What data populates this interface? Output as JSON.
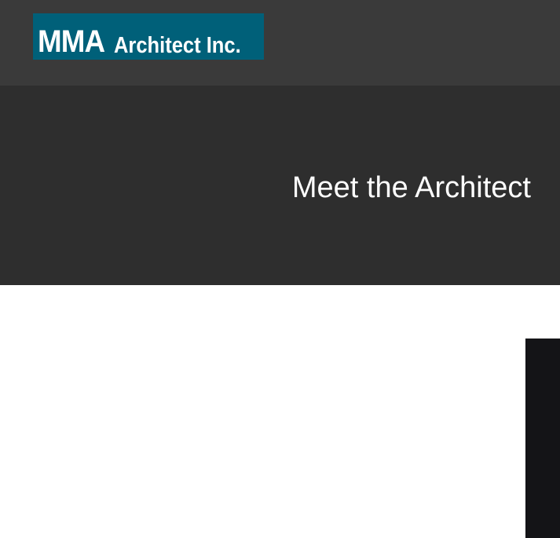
{
  "header": {
    "logo": {
      "mark": "MMA",
      "text": "Architect Inc.",
      "background_color": "#006079"
    },
    "background_color": "#3a3a3a"
  },
  "hero": {
    "title": "Meet the Architect",
    "background_color": "#2e2e2e"
  },
  "content": {
    "side_panel_color": "#141417"
  }
}
